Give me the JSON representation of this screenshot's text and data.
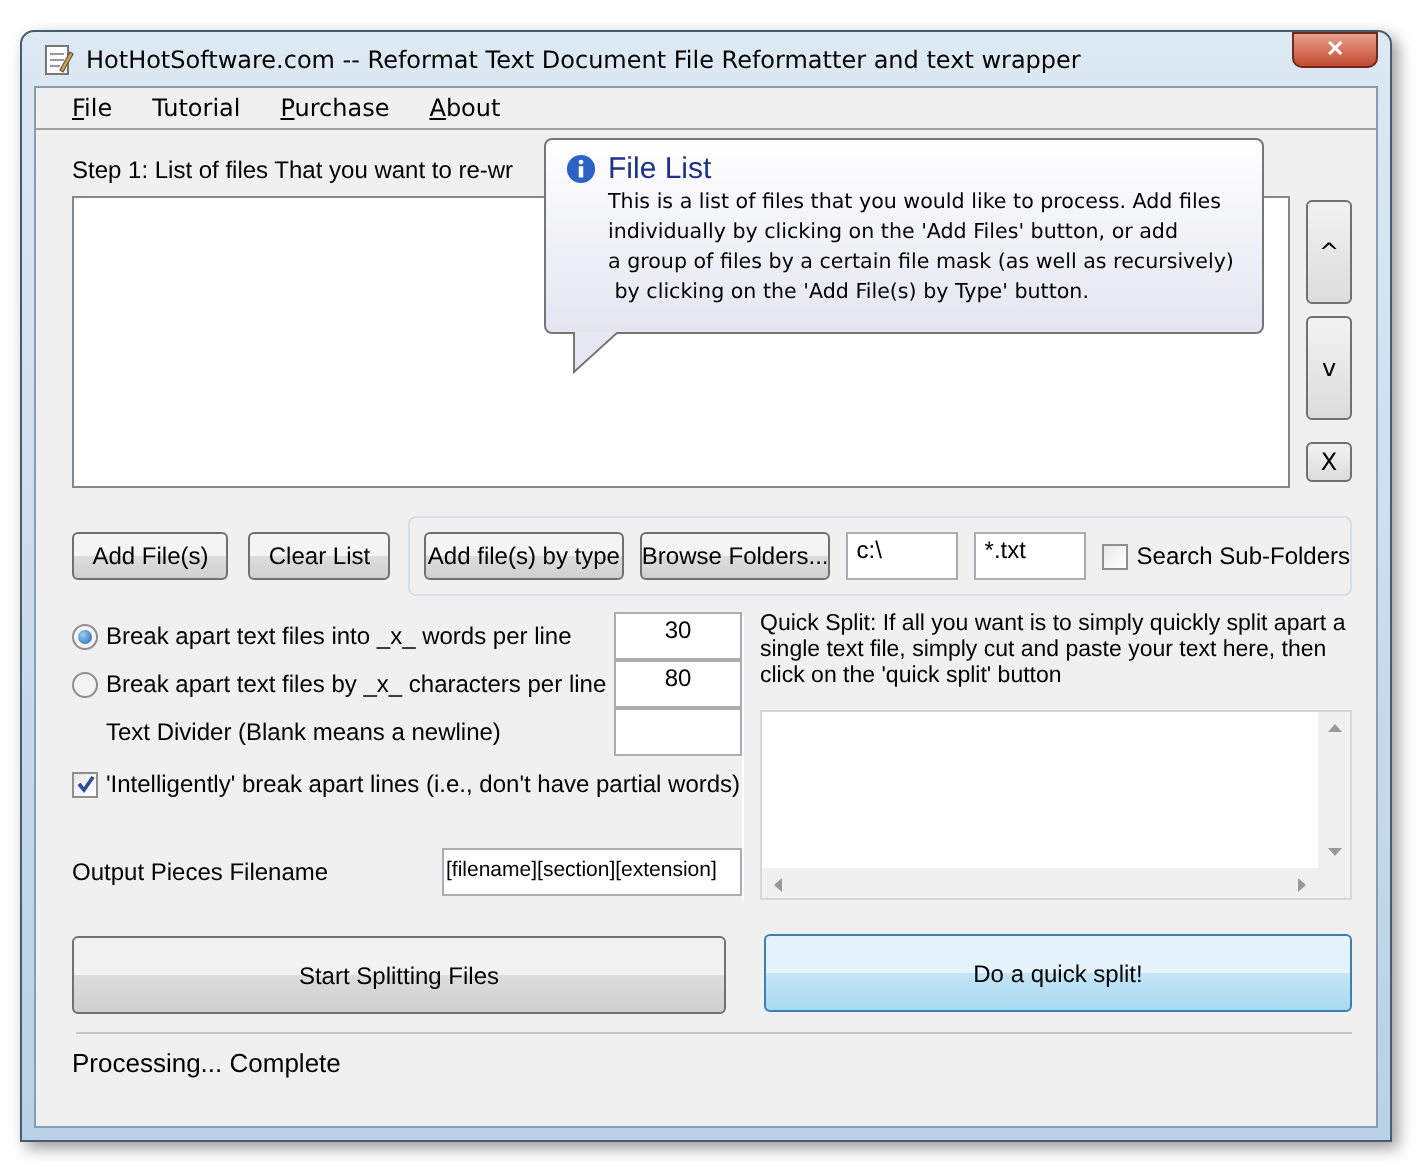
{
  "window": {
    "title": "HotHotSoftware.com -- Reformat Text Document File Reformatter and text wrapper",
    "close": "✕"
  },
  "menu": [
    {
      "label": "File",
      "mnemonic": true
    },
    {
      "label": "Tutorial",
      "mnemonic": false
    },
    {
      "label": "Purchase",
      "mnemonic": true
    },
    {
      "label": "About",
      "mnemonic": true
    }
  ],
  "step_label": "Step 1: List of files That you want to re-wr",
  "list_buttons": [
    "^",
    "v",
    "X"
  ],
  "tooltip": {
    "title": "File List",
    "lines": [
      "This is a list of files that you would like to process. Add files",
      "individually by clicking on the 'Add Files' button, or add",
      "a group of files by a certain file mask (as well as recursively)",
      " by clicking on the 'Add File(s) by Type' button."
    ]
  },
  "file_buttons": [
    "Add File(s)",
    "Clear List"
  ],
  "type_group": {
    "buttons": [
      "Add file(s) by type",
      "Browse Folders..."
    ],
    "folder": "c:\\",
    "mask": "*.txt",
    "search_sub": {
      "label": "Search Sub-Folders",
      "checked": false
    }
  },
  "options": [
    {
      "kind": "radio",
      "label": "Break apart text files into _x_ words per line",
      "selected": true,
      "value": "30"
    },
    {
      "kind": "radio",
      "label": "Break apart text files by _x_ characters per line",
      "selected": false,
      "value": "80"
    },
    {
      "kind": "field",
      "label": "Text Divider (Blank means a newline)"
    }
  ],
  "intelligent": {
    "label": "'Intelligently' break apart lines (i.e., don't have partial words)",
    "checked": true
  },
  "output": {
    "label": "Output Pieces Filename",
    "value": "[filename][section][extension]"
  },
  "start_button": "Start Splitting Files",
  "quick_split": {
    "text": "Quick Split: If all you want is to simply quickly split apart a single text file, simply cut and paste your text here, then click on the 'quick split' button",
    "button": "Do a quick split!"
  },
  "status": "Processing... Complete"
}
